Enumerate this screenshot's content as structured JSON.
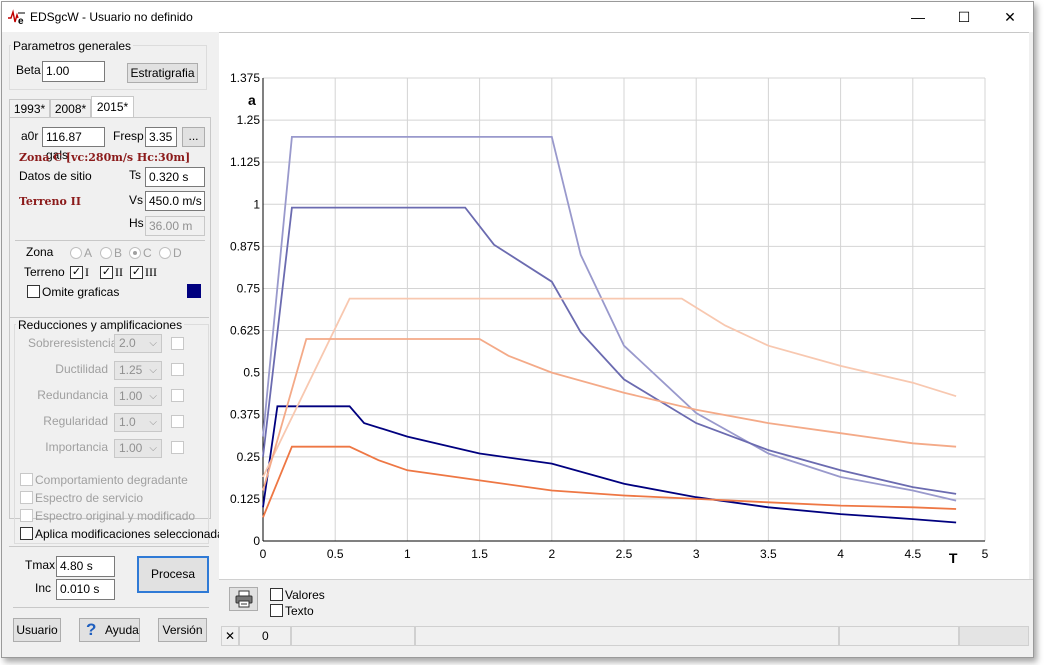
{
  "window": {
    "title": "EDSgcW - Usuario no definido",
    "minimize": "—",
    "maximize": "☐",
    "close": "✕"
  },
  "params": {
    "group_label": "Parametros generales",
    "beta_label": "Beta",
    "beta_value": "1.00",
    "estratigrafia": "Estratigrafia"
  },
  "tabs": [
    {
      "label": "1993*"
    },
    {
      "label": "2008*"
    },
    {
      "label": "2015*"
    }
  ],
  "site": {
    "a0r_label": "a0r",
    "a0r_value": "116.87 gals",
    "fresp_label": "Fresp",
    "fresp_value": "3.35",
    "more_button": "...",
    "zona_text": "Zona C  [vc:280m/s  Hc:30m]",
    "datos_label": "Datos de sitio",
    "ts_label": "Ts",
    "ts_value": "0.320 s",
    "terreno_text": "Terreno II",
    "vs_label": "Vs",
    "vs_value": "450.0 m/s",
    "hs_label": "Hs",
    "hs_value": "36.00 m"
  },
  "zona": {
    "label": "Zona",
    "options": [
      "A",
      "B",
      "C",
      "D"
    ],
    "selected": "C"
  },
  "terreno": {
    "label": "Terreno",
    "options": [
      "I",
      "II",
      "III"
    ],
    "checked": "✓"
  },
  "omite": {
    "label": "Omite graficas",
    "color": "#00007f"
  },
  "reducciones": {
    "group_label": "Reducciones y amplificaciones",
    "rows": [
      {
        "label": "Sobreresistencia",
        "value": "2.0"
      },
      {
        "label": "Ductilidad",
        "value": "1.25"
      },
      {
        "label": "Redundancia",
        "value": "1.00"
      },
      {
        "label": "Regularidad",
        "value": "1.0"
      },
      {
        "label": "Importancia",
        "value": "1.00"
      }
    ],
    "options": [
      {
        "label": "Comportamiento degradante"
      },
      {
        "label": "Espectro de servicio"
      },
      {
        "label": "Espectro original y modificado"
      },
      {
        "label": "Aplica modificaciones seleccionadas"
      }
    ]
  },
  "tmax": {
    "label": "Tmax",
    "value": "4.80 s"
  },
  "inc": {
    "label": "Inc",
    "value": "0.010 s"
  },
  "procesa": "Procesa",
  "bottom_buttons": {
    "usuario": "Usuario",
    "ayuda": "Ayuda",
    "version": "Versión",
    "help_glyph": "?"
  },
  "chart_options": {
    "valores": "Valores",
    "texto": "Texto",
    "print_icon": "printer-icon"
  },
  "status": {
    "close_glyph": "✕",
    "count": "0"
  },
  "chart_data": {
    "type": "line",
    "ylabel": "a",
    "xlabel": "T",
    "xlim": [
      0,
      5
    ],
    "ylim": [
      0,
      1.375
    ],
    "x_ticks": [
      "0",
      "0.5",
      "1",
      "1.5",
      "2",
      "2.5",
      "3",
      "3.5",
      "4",
      "4.5",
      "5"
    ],
    "y_ticks": [
      "0",
      "0.125",
      "0.25",
      "0.375",
      "0.5",
      "0.625",
      "0.75",
      "0.875",
      "1",
      "1.125",
      "1.25",
      "1.375"
    ],
    "grid": true,
    "series": [
      {
        "color": "#9999cc",
        "points": [
          [
            0,
            0.31
          ],
          [
            0.2,
            1.2
          ],
          [
            2.0,
            1.2
          ],
          [
            2.2,
            0.85
          ],
          [
            2.5,
            0.58
          ],
          [
            3.0,
            0.38
          ],
          [
            3.5,
            0.26
          ],
          [
            4.0,
            0.19
          ],
          [
            4.5,
            0.15
          ],
          [
            4.8,
            0.12
          ]
        ]
      },
      {
        "color": "#6b6bb0",
        "points": [
          [
            0,
            0.25
          ],
          [
            0.2,
            0.99
          ],
          [
            1.4,
            0.99
          ],
          [
            1.6,
            0.88
          ],
          [
            2.0,
            0.77
          ],
          [
            2.2,
            0.62
          ],
          [
            2.5,
            0.48
          ],
          [
            3.0,
            0.35
          ],
          [
            3.5,
            0.27
          ],
          [
            4.0,
            0.21
          ],
          [
            4.5,
            0.16
          ],
          [
            4.8,
            0.14
          ]
        ]
      },
      {
        "color": "#00007f",
        "points": [
          [
            0,
            0.1
          ],
          [
            0.1,
            0.4
          ],
          [
            0.6,
            0.4
          ],
          [
            0.7,
            0.35
          ],
          [
            1.0,
            0.31
          ],
          [
            1.5,
            0.26
          ],
          [
            2.0,
            0.23
          ],
          [
            2.5,
            0.17
          ],
          [
            3.0,
            0.13
          ],
          [
            3.5,
            0.1
          ],
          [
            4.0,
            0.08
          ],
          [
            4.5,
            0.065
          ],
          [
            4.8,
            0.055
          ]
        ]
      },
      {
        "color": "#f8c8b0",
        "points": [
          [
            0,
            0.19
          ],
          [
            0.6,
            0.72
          ],
          [
            2.9,
            0.72
          ],
          [
            3.2,
            0.64
          ],
          [
            3.5,
            0.58
          ],
          [
            4.0,
            0.52
          ],
          [
            4.5,
            0.47
          ],
          [
            4.8,
            0.43
          ]
        ]
      },
      {
        "color": "#f4aa88",
        "points": [
          [
            0,
            0.15
          ],
          [
            0.3,
            0.6
          ],
          [
            1.5,
            0.6
          ],
          [
            1.7,
            0.55
          ],
          [
            2.0,
            0.5
          ],
          [
            2.5,
            0.44
          ],
          [
            3.0,
            0.39
          ],
          [
            3.5,
            0.35
          ],
          [
            4.0,
            0.32
          ],
          [
            4.5,
            0.29
          ],
          [
            4.8,
            0.28
          ]
        ]
      },
      {
        "color": "#ee7744",
        "points": [
          [
            0,
            0.07
          ],
          [
            0.2,
            0.28
          ],
          [
            0.6,
            0.28
          ],
          [
            0.8,
            0.24
          ],
          [
            1.0,
            0.21
          ],
          [
            1.5,
            0.18
          ],
          [
            2.0,
            0.15
          ],
          [
            2.5,
            0.135
          ],
          [
            3.0,
            0.125
          ],
          [
            3.5,
            0.115
          ],
          [
            4.0,
            0.105
          ],
          [
            4.5,
            0.1
          ],
          [
            4.8,
            0.095
          ]
        ]
      }
    ]
  }
}
